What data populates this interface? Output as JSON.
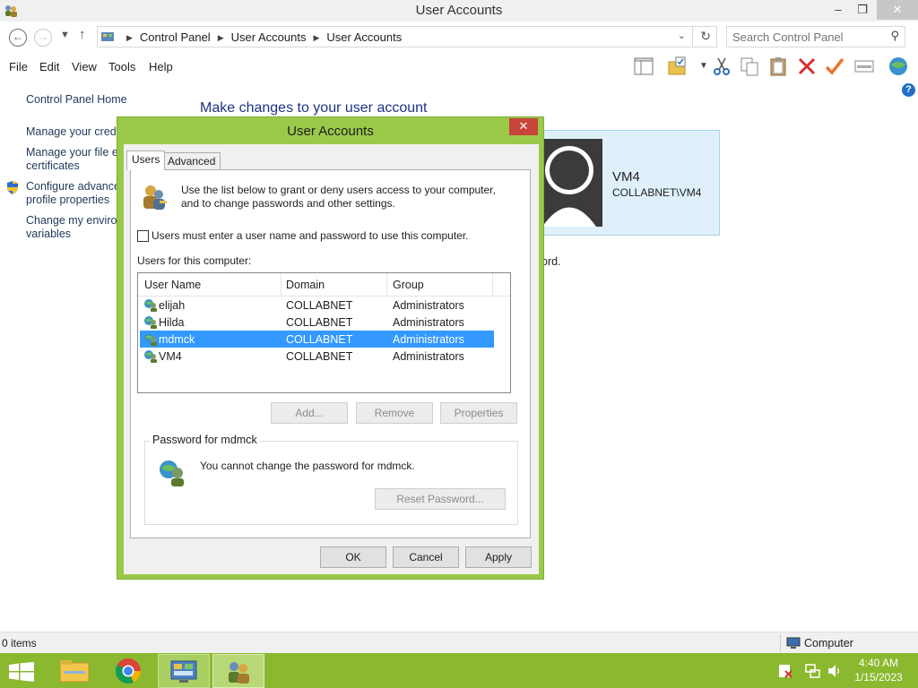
{
  "window": {
    "title": "User Accounts",
    "minimize": "–",
    "maximize": "❐",
    "close": "✕"
  },
  "address": {
    "crumbs": [
      "Control Panel",
      "User Accounts",
      "User Accounts"
    ],
    "search_placeholder": "Search Control Panel"
  },
  "menu": [
    "File",
    "Edit",
    "View",
    "Tools",
    "Help"
  ],
  "toolbar_icons": [
    "pane-icon",
    "properties-folder-icon",
    "cut-icon",
    "copy-icon",
    "paste-icon",
    "delete-icon",
    "check-icon",
    "view-icon",
    "globe-icon"
  ],
  "left_links": {
    "home": "Control Panel Home",
    "manage_credentials": "Manage your crede",
    "manage_file_1": "Manage your file er",
    "manage_file_2": "certificates",
    "configure_1": "Configure advance",
    "configure_2": "profile properties",
    "change_env_1": "Change my environ",
    "change_env_2": "variables"
  },
  "main": {
    "heading": "Make changes to your user account",
    "user_name": "VM4",
    "user_domain": "COLLABNET\\VM4",
    "word_tail": "ord."
  },
  "status": {
    "items": "0 items",
    "location": "Computer"
  },
  "taskbar": {
    "time": "4:40 AM",
    "date": "1/15/2023"
  },
  "dialog": {
    "title": "User Accounts",
    "close": "✕",
    "tabs": [
      "Users",
      "Advanced"
    ],
    "intro_line1": "Use the list below to grant or deny users access to your computer,",
    "intro_line2": "and to change passwords and other settings.",
    "checkbox_label": "Users must enter a user name and password to use this computer.",
    "checkbox_checked": false,
    "list_label": "Users for this computer:",
    "columns": [
      "User Name",
      "Domain",
      "Group"
    ],
    "rows": [
      {
        "name": "elijah",
        "domain": "COLLABNET",
        "group": "Administrators"
      },
      {
        "name": "Hilda",
        "domain": "COLLABNET",
        "group": "Administrators"
      },
      {
        "name": "mdmck",
        "domain": "COLLABNET",
        "group": "Administrators"
      },
      {
        "name": "VM4",
        "domain": "COLLABNET",
        "group": "Administrators"
      }
    ],
    "selected_row": 2,
    "add": "Add...",
    "remove": "Remove",
    "properties": "Properties",
    "password_group": "Password for mdmck",
    "password_text": "You cannot change the password for mdmck.",
    "reset_password": "Reset Password...",
    "ok": "OK",
    "cancel": "Cancel",
    "apply": "Apply"
  },
  "colors": {
    "dialog_frame": "#9ac94a",
    "taskbar": "#8ab82e",
    "selection": "#3399ff",
    "link": "#1e395b",
    "heading": "#1e3287"
  }
}
